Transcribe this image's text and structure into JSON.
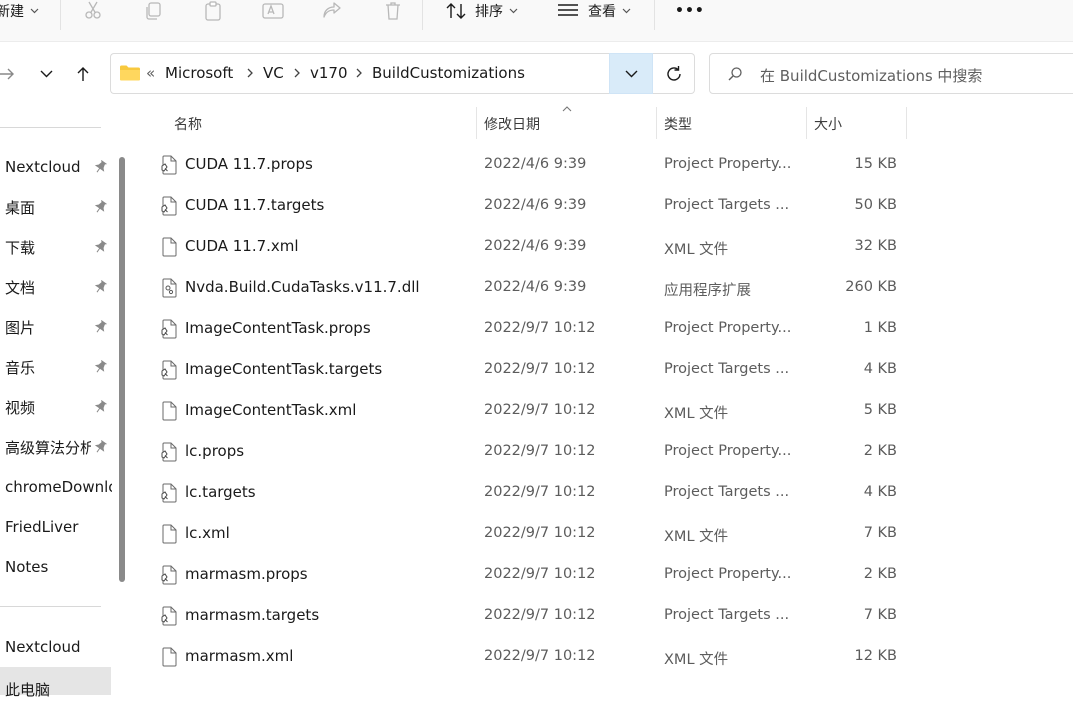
{
  "toolbar": {
    "new_label": "新建",
    "sort_label": "排序",
    "view_label": "查看",
    "more_label": "•••"
  },
  "address": {
    "overflow": "«",
    "crumbs": [
      "Microsoft",
      "VC",
      "v170",
      "BuildCustomizations"
    ]
  },
  "search": {
    "placeholder": "在 BuildCustomizations 中搜索"
  },
  "sidebar": {
    "pinned": [
      {
        "label": "Nextcloud"
      },
      {
        "label": "桌面"
      },
      {
        "label": "下载"
      },
      {
        "label": "文档"
      },
      {
        "label": "图片"
      },
      {
        "label": "音乐"
      },
      {
        "label": "视频"
      },
      {
        "label": "高级算法分析"
      }
    ],
    "others": [
      {
        "label": "chromeDownloads"
      },
      {
        "label": "FriedLiver"
      },
      {
        "label": "Notes"
      }
    ],
    "bottom": [
      {
        "label": "Nextcloud"
      },
      {
        "label": "此电脑"
      }
    ]
  },
  "columns": {
    "name": "名称",
    "date": "修改日期",
    "type": "类型",
    "size": "大小"
  },
  "files": [
    {
      "name": "CUDA 11.7.props",
      "date": "2022/4/6 9:39",
      "type": "Project Property...",
      "size": "15 KB",
      "icon": "project-file-icon"
    },
    {
      "name": "CUDA 11.7.targets",
      "date": "2022/4/6 9:39",
      "type": "Project Targets ...",
      "size": "50 KB",
      "icon": "project-file-icon"
    },
    {
      "name": "CUDA 11.7.xml",
      "date": "2022/4/6 9:39",
      "type": "XML 文件",
      "size": "32 KB",
      "icon": "blank-file-icon"
    },
    {
      "name": "Nvda.Build.CudaTasks.v11.7.dll",
      "date": "2022/4/6 9:39",
      "type": "应用程序扩展",
      "size": "260 KB",
      "icon": "dll-file-icon"
    },
    {
      "name": "ImageContentTask.props",
      "date": "2022/9/7 10:12",
      "type": "Project Property...",
      "size": "1 KB",
      "icon": "project-file-icon"
    },
    {
      "name": "ImageContentTask.targets",
      "date": "2022/9/7 10:12",
      "type": "Project Targets ...",
      "size": "4 KB",
      "icon": "project-file-icon"
    },
    {
      "name": "ImageContentTask.xml",
      "date": "2022/9/7 10:12",
      "type": "XML 文件",
      "size": "5 KB",
      "icon": "blank-file-icon"
    },
    {
      "name": "lc.props",
      "date": "2022/9/7 10:12",
      "type": "Project Property...",
      "size": "2 KB",
      "icon": "project-file-icon"
    },
    {
      "name": "lc.targets",
      "date": "2022/9/7 10:12",
      "type": "Project Targets ...",
      "size": "4 KB",
      "icon": "project-file-icon"
    },
    {
      "name": "lc.xml",
      "date": "2022/9/7 10:12",
      "type": "XML 文件",
      "size": "7 KB",
      "icon": "blank-file-icon"
    },
    {
      "name": "marmasm.props",
      "date": "2022/9/7 10:12",
      "type": "Project Property...",
      "size": "2 KB",
      "icon": "project-file-icon"
    },
    {
      "name": "marmasm.targets",
      "date": "2022/9/7 10:12",
      "type": "Project Targets ...",
      "size": "7 KB",
      "icon": "project-file-icon"
    },
    {
      "name": "marmasm.xml",
      "date": "2022/9/7 10:12",
      "type": "XML 文件",
      "size": "12 KB",
      "icon": "blank-file-icon"
    }
  ]
}
